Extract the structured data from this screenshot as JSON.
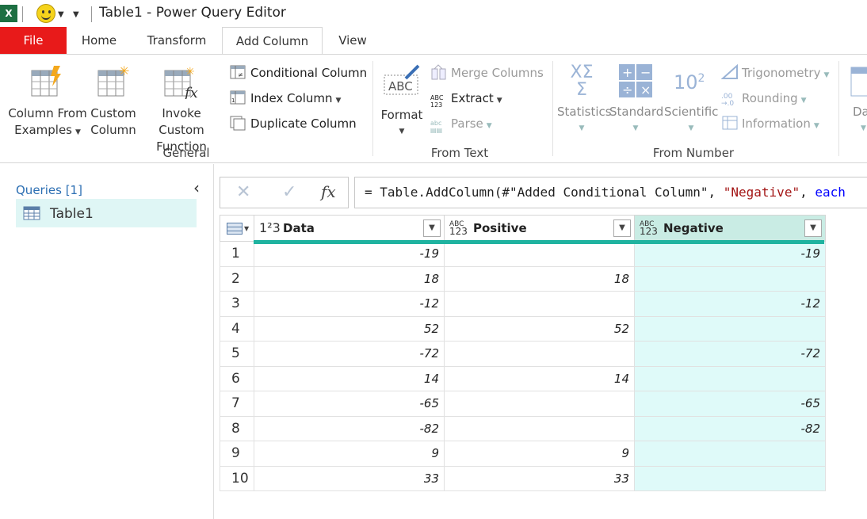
{
  "titlebar": {
    "title": "Table1 - Power Query Editor",
    "app_icon": "X",
    "icons": [
      "excel-icon",
      "smiley-icon",
      "chevron-down-icon"
    ]
  },
  "tabs": [
    {
      "label": "File"
    },
    {
      "label": "Home"
    },
    {
      "label": "Transform"
    },
    {
      "label": "Add Column",
      "active": true
    },
    {
      "label": "View"
    }
  ],
  "ribbon": {
    "general": {
      "label": "General",
      "column_from_examples": [
        "Column From",
        "Examples"
      ],
      "custom_column": [
        "Custom",
        "Column"
      ],
      "invoke_custom_function": [
        "Invoke Custom",
        "Function"
      ],
      "conditional_column": "Conditional Column",
      "index_column": "Index Column",
      "duplicate_column": "Duplicate Column"
    },
    "from_text": {
      "label": "From Text",
      "format": "Format",
      "merge_columns": "Merge Columns",
      "extract": "Extract",
      "parse": "Parse"
    },
    "from_number": {
      "label": "From Number",
      "statistics": "Statistics",
      "standard": "Standard",
      "scientific": "Scientific",
      "trigonometry": "Trigonometry",
      "rounding": "Rounding",
      "information": "Information"
    },
    "partial_next": "Da"
  },
  "queries": {
    "header": "Queries [1]",
    "items": [
      {
        "label": "Table1"
      }
    ]
  },
  "formula": {
    "prefix": "= Table.AddColumn(#\"Added Conditional Column\", ",
    "string": "\"Negative\"",
    "sep": ", ",
    "keyword": "each"
  },
  "grid": {
    "columns": [
      {
        "name": "Data",
        "type": "1²3"
      },
      {
        "name": "Positive",
        "type_top": "ABC",
        "type_bottom": "123"
      },
      {
        "name": "Negative",
        "type_top": "ABC",
        "type_bottom": "123"
      }
    ],
    "rows": [
      {
        "n": "1",
        "data": "-19",
        "pos": "",
        "neg": "-19"
      },
      {
        "n": "2",
        "data": "18",
        "pos": "18",
        "neg": ""
      },
      {
        "n": "3",
        "data": "-12",
        "pos": "",
        "neg": "-12"
      },
      {
        "n": "4",
        "data": "52",
        "pos": "52",
        "neg": ""
      },
      {
        "n": "5",
        "data": "-72",
        "pos": "",
        "neg": "-72"
      },
      {
        "n": "6",
        "data": "14",
        "pos": "14",
        "neg": ""
      },
      {
        "n": "7",
        "data": "-65",
        "pos": "",
        "neg": "-65"
      },
      {
        "n": "8",
        "data": "-82",
        "pos": "",
        "neg": "-82"
      },
      {
        "n": "9",
        "data": "9",
        "pos": "9",
        "neg": ""
      },
      {
        "n": "10",
        "data": "33",
        "pos": "33",
        "neg": ""
      }
    ]
  },
  "colors": {
    "file_tab": "#e81a1a",
    "accent_teal": "#1fb3a0",
    "selected_query": "#dff6f5",
    "selected_column": "#dffaf9"
  }
}
